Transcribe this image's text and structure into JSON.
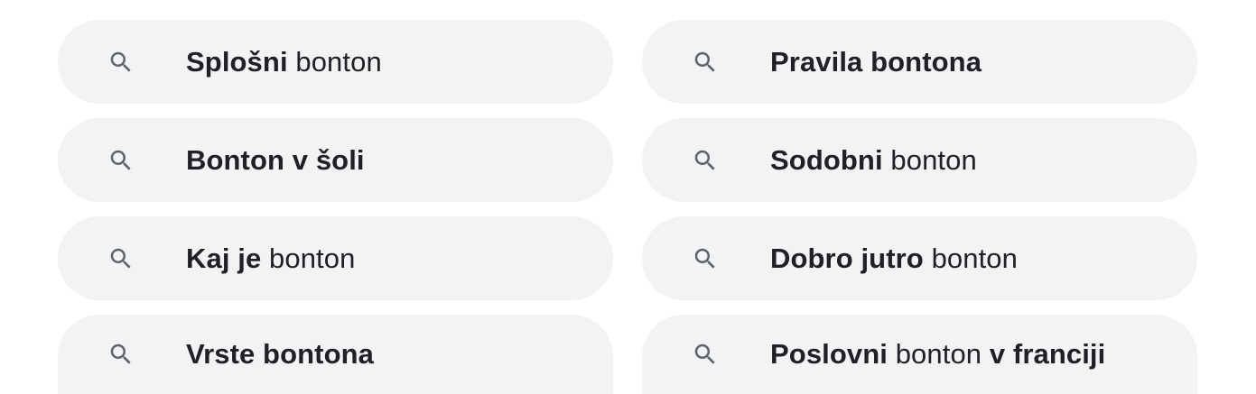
{
  "suggestions": [
    {
      "segments": [
        {
          "text": "Splošni",
          "bold": true
        },
        {
          "text": " bonton",
          "bold": false
        }
      ]
    },
    {
      "segments": [
        {
          "text": "Pravila bontona",
          "bold": true
        }
      ]
    },
    {
      "segments": [
        {
          "text": "Bonton v šoli",
          "bold": true
        }
      ]
    },
    {
      "segments": [
        {
          "text": "Sodobni",
          "bold": true
        },
        {
          "text": " bonton",
          "bold": false
        }
      ]
    },
    {
      "segments": [
        {
          "text": "Kaj je",
          "bold": true
        },
        {
          "text": " bonton",
          "bold": false
        }
      ]
    },
    {
      "segments": [
        {
          "text": "Dobro jutro",
          "bold": true
        },
        {
          "text": " bonton",
          "bold": false
        }
      ]
    },
    {
      "segments": [
        {
          "text": "Vrste bontona",
          "bold": true
        }
      ]
    },
    {
      "segments": [
        {
          "text": "Poslovni",
          "bold": true
        },
        {
          "text": " bonton ",
          "bold": false
        },
        {
          "text": "v franciji",
          "bold": true
        }
      ]
    }
  ],
  "icon": "search-icon",
  "colors": {
    "chip_bg": "#f1f3f4",
    "text": "#202124",
    "icon": "#5f6368"
  }
}
